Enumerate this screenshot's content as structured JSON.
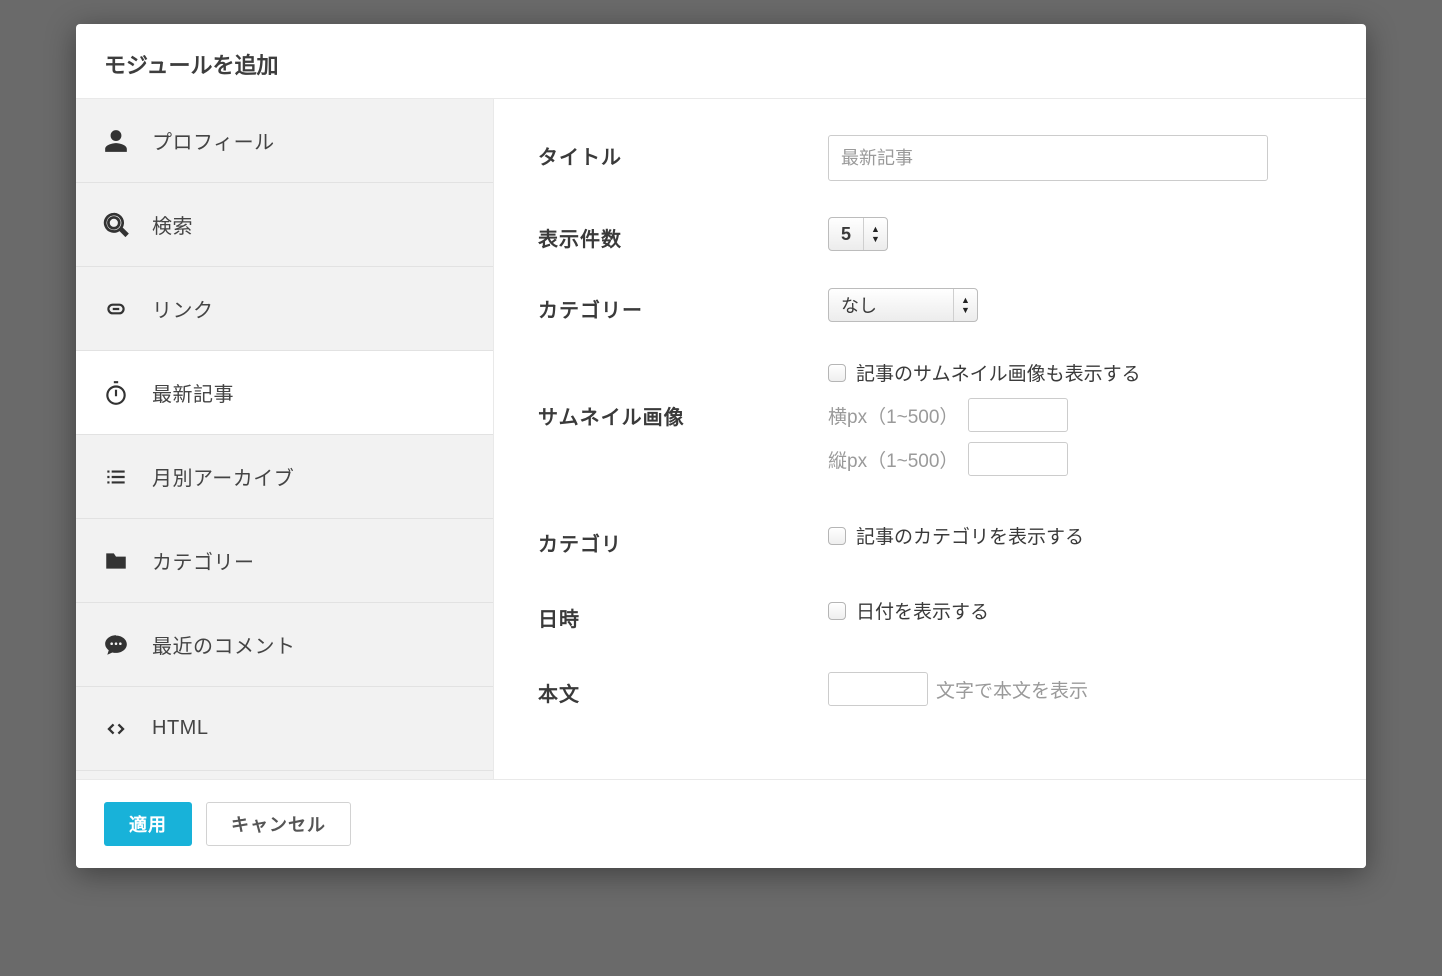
{
  "header": {
    "title": "モジュールを追加"
  },
  "sidebar": {
    "items": [
      {
        "label": "プロフィール"
      },
      {
        "label": "検索"
      },
      {
        "label": "リンク"
      },
      {
        "label": "最新記事"
      },
      {
        "label": "月別アーカイブ"
      },
      {
        "label": "カテゴリー"
      },
      {
        "label": "最近のコメント"
      },
      {
        "label": "HTML"
      }
    ]
  },
  "form": {
    "title_label": "タイトル",
    "title_placeholder": "最新記事",
    "count_label": "表示件数",
    "count_value": "5",
    "category_label": "カテゴリー",
    "category_value": "なし",
    "thumbnail_label": "サムネイル画像",
    "thumbnail_check_label": "記事のサムネイル画像も表示する",
    "thumbnail_width_prefix": "横px（1~500）",
    "thumbnail_height_prefix": "縦px（1~500）",
    "category_display_label": "カテゴリ",
    "category_display_check_label": "記事のカテゴリを表示する",
    "datetime_label": "日時",
    "datetime_check_label": "日付を表示する",
    "body_label": "本文",
    "body_suffix": "文字で本文を表示"
  },
  "footer": {
    "apply": "適用",
    "cancel": "キャンセル"
  }
}
